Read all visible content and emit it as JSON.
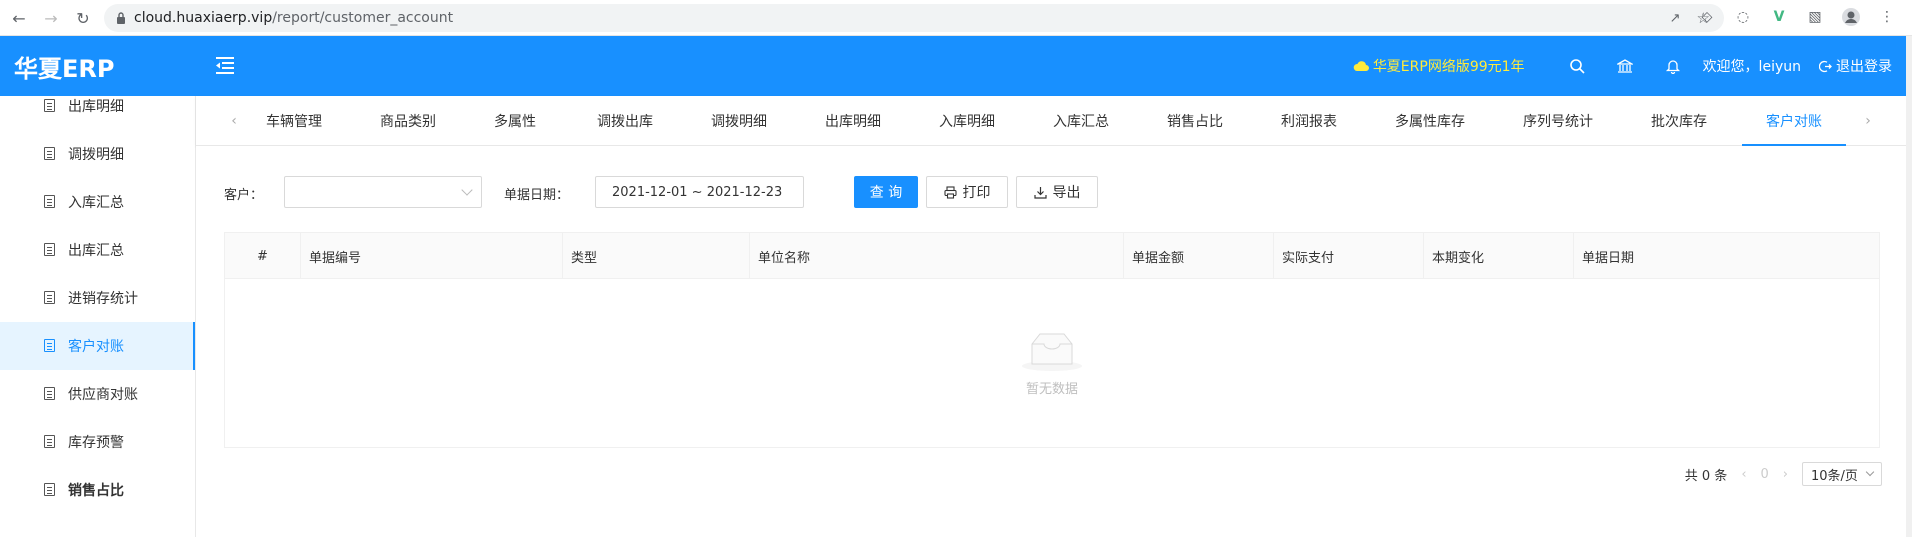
{
  "browser": {
    "url_host": "cloud.huaxiaerp.vip",
    "url_path": "/report/customer_account"
  },
  "header": {
    "logo": "华夏ERP",
    "promo": "华夏ERP网络版99元1年",
    "welcome": "欢迎您，leiyun",
    "logout": "退出登录"
  },
  "sidebar": {
    "items": [
      {
        "label": "出库明细"
      },
      {
        "label": "调拨明细"
      },
      {
        "label": "入库汇总"
      },
      {
        "label": "出库汇总"
      },
      {
        "label": "进销存统计"
      },
      {
        "label": "客户对账"
      },
      {
        "label": "供应商对账"
      },
      {
        "label": "库存预警"
      },
      {
        "label": "销售占比"
      }
    ]
  },
  "tabs": [
    {
      "label": "车辆管理"
    },
    {
      "label": "商品类别"
    },
    {
      "label": "多属性"
    },
    {
      "label": "调拨出库"
    },
    {
      "label": "调拨明细"
    },
    {
      "label": "出库明细"
    },
    {
      "label": "入库明细"
    },
    {
      "label": "入库汇总"
    },
    {
      "label": "销售占比"
    },
    {
      "label": "利润报表"
    },
    {
      "label": "多属性库存"
    },
    {
      "label": "序列号统计"
    },
    {
      "label": "批次库存"
    },
    {
      "label": "客户对账"
    }
  ],
  "filters": {
    "customer_label": "客户：",
    "customer_value": "",
    "date_label": "单据日期：",
    "date_value": "2021-12-01 ~ 2021-12-23",
    "query_label": "查 询",
    "print_label": "打印",
    "export_label": "导出"
  },
  "table": {
    "columns": [
      "#",
      "单据编号",
      "类型",
      "单位名称",
      "单据金额",
      "实际支付",
      "本期变化",
      "单据日期"
    ],
    "empty_text": "暂无数据"
  },
  "pager": {
    "total": "共 0 条",
    "page": "0",
    "page_size": "10条/页"
  },
  "colors": {
    "primary": "#1890ff",
    "promo": "#ffeb3b"
  }
}
